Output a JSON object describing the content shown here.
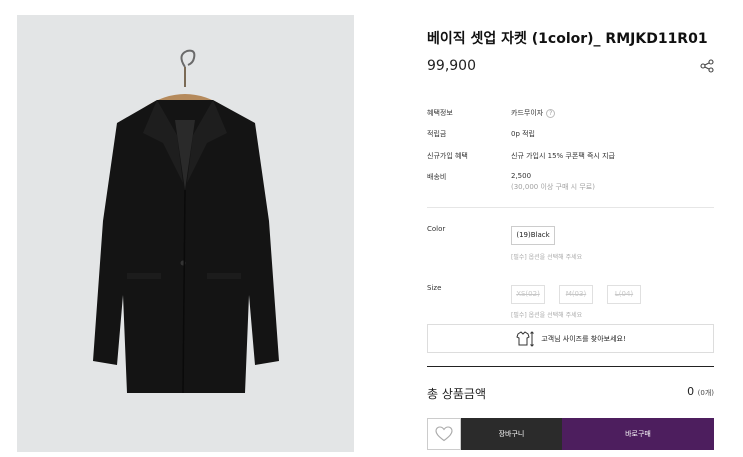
{
  "product": {
    "title": "베이직 셋업 자켓 (1color)_ RMJKD11R01",
    "price": "99,900"
  },
  "specs": [
    {
      "label": "혜택정보",
      "value": "카드무이자",
      "help": "?"
    },
    {
      "label": "적립금",
      "value": "0p 적립"
    },
    {
      "label": "신규가입 혜택",
      "value": "신규 가입시 15% 쿠폰팩 즉시 지급"
    },
    {
      "label": "배송비",
      "value": "2,500",
      "sub": "(30,000 이상 구매 시 무료)"
    }
  ],
  "options": {
    "color": {
      "label": "Color",
      "choices": [
        "(19)Black"
      ],
      "hint": "[필수] 옵션을 선택해 주세요"
    },
    "size": {
      "label": "Size",
      "choices": [
        "XS(02)",
        "M(03)",
        "L(04)"
      ],
      "hint": "[필수] 옵션을 선택해 주세요"
    }
  },
  "size_finder": {
    "label": "고객님 사이즈를 찾아보세요!"
  },
  "total": {
    "label": "총 상품금액",
    "value": "0",
    "count": "(0개)"
  },
  "buttons": {
    "cart": "장바구니",
    "buy": "바로구매"
  },
  "colors": {
    "buy_button": "#4d1e5e",
    "cart_button": "#2b2b2b"
  },
  "icons": {
    "share": "share-icon",
    "like": "heart-icon",
    "size_finder": "shirt-ruler-icon"
  }
}
